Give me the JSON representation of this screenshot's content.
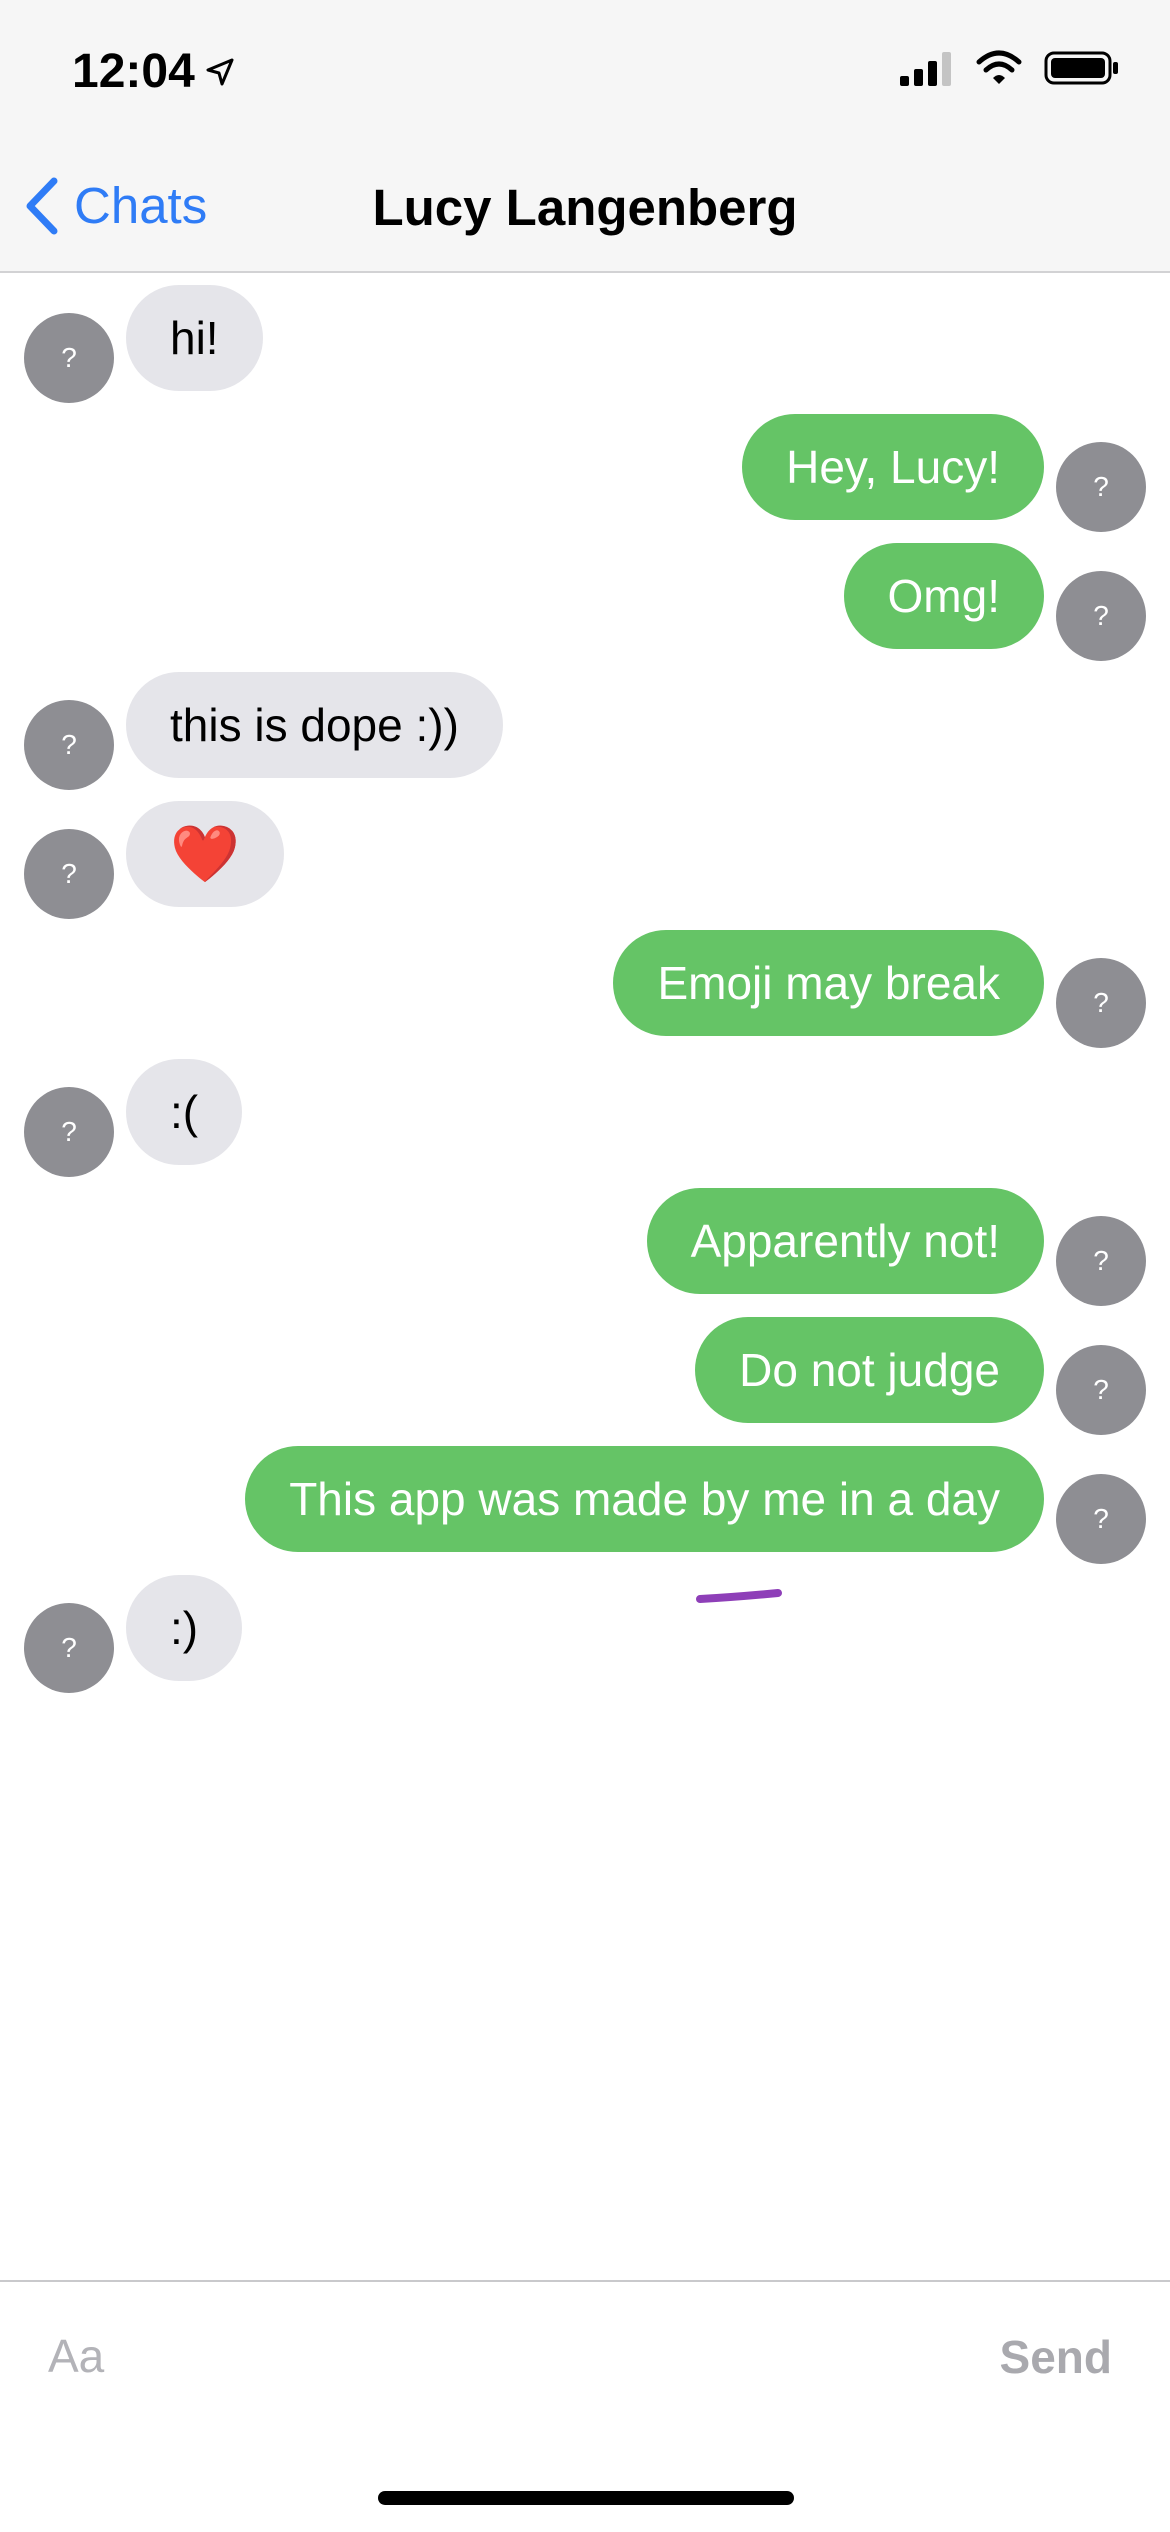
{
  "status_bar": {
    "time": "12:04",
    "icons": [
      "location-arrow-icon",
      "cellular-signal-icon",
      "wifi-icon",
      "battery-icon"
    ]
  },
  "nav": {
    "back_label": "Chats",
    "title": "Lucy Langenberg"
  },
  "messages": [
    {
      "direction": "in",
      "text": "hi!",
      "avatar": "?"
    },
    {
      "direction": "out",
      "text": "Hey, Lucy!",
      "avatar": "?"
    },
    {
      "direction": "out",
      "text": "Omg!",
      "avatar": "?"
    },
    {
      "direction": "in",
      "text": "this is dope :))",
      "avatar": "?"
    },
    {
      "direction": "in",
      "text": "❤️",
      "avatar": "?"
    },
    {
      "direction": "out",
      "text": "Emoji may break",
      "avatar": "?"
    },
    {
      "direction": "in",
      "text": ":(",
      "avatar": "?"
    },
    {
      "direction": "out",
      "text": "Apparently not!",
      "avatar": "?"
    },
    {
      "direction": "out",
      "text": "Do not judge",
      "avatar": "?"
    },
    {
      "direction": "out",
      "text": "This app was made by me in a day",
      "avatar": "?"
    },
    {
      "direction": "in",
      "text": ":)",
      "avatar": "?"
    }
  ],
  "composer": {
    "placeholder": "Aa",
    "value": "",
    "send_label": "Send"
  },
  "colors": {
    "outgoing_bubble": "#65c466",
    "incoming_bubble": "#e5e5ea",
    "avatar": "#8e8e93",
    "accent": "#2f7cf6"
  }
}
